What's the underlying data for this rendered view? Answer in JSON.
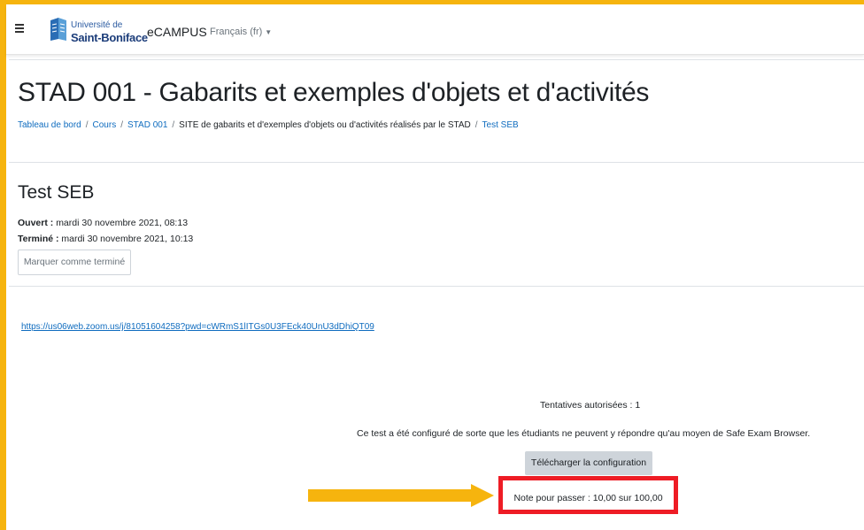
{
  "header": {
    "logo_line1": "Université de",
    "logo_line2": "Saint-Boniface",
    "brand": "eCAMPUS",
    "language": "Français (fr)"
  },
  "page": {
    "title": "STAD 001 - Gabarits et exemples d'objets et d'activités",
    "breadcrumb": [
      "Tableau de bord",
      "Cours",
      "STAD 001",
      "SITE de gabarits et d'exemples d'objets ou d'activités réalisés par le STAD",
      "Test SEB"
    ]
  },
  "activity": {
    "title": "Test SEB",
    "opened_label": "Ouvert :",
    "opened_value": "mardi 30 novembre 2021, 08:13",
    "closed_label": "Terminé :",
    "closed_value": "mardi 30 novembre 2021, 10:13",
    "mark_done_button": "Marquer comme terminé",
    "zoom_link": "https://us06web.zoom.us/j/81051604258?pwd=cWRmS1lITGs0U3FEck40UnU3dDhiQT09"
  },
  "quiz": {
    "attempts": "Tentatives autorisées : 1",
    "seb_notice": "Ce test a été configuré de sorte que les étudiants ne peuvent y répondre qu'au moyen de Safe Exam Browser.",
    "download_button": "Télécharger la configuration",
    "pass_grade": "Note pour passer : 10,00 sur 100,00"
  },
  "colors": {
    "highlight_frame": "#f6b40e",
    "callout_box": "#ee1c25",
    "link": "#0f6cbf"
  }
}
